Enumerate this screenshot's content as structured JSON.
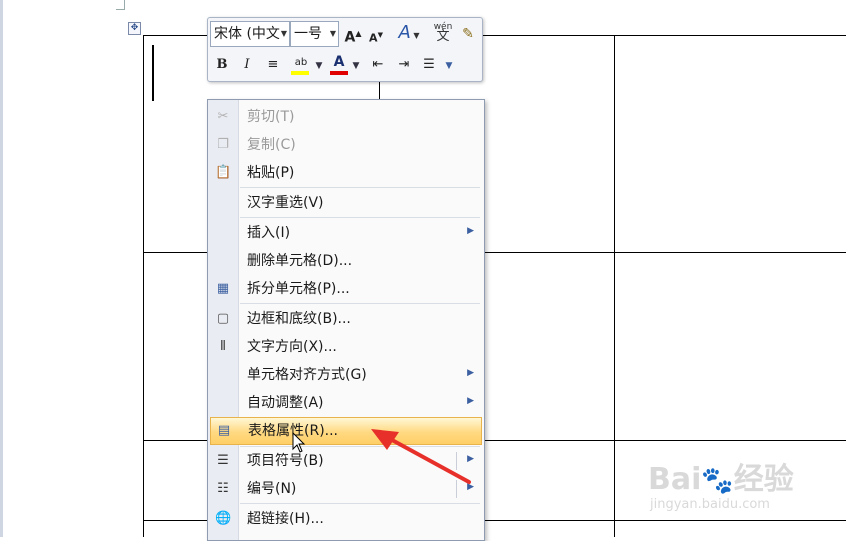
{
  "mini_toolbar": {
    "font_name": "宋体 (中文",
    "font_size": "一号",
    "grow_font": "A",
    "shrink_font": "A",
    "styles": "A",
    "phonetic": "wén",
    "bold": "B",
    "italic": "I",
    "highlight": "ab",
    "font_color": "A",
    "highlight_color": "#ffff00",
    "font_color_value": "#e00000"
  },
  "context_menu": {
    "items": [
      {
        "label": "剪切(T)",
        "icon": "scissors-icon",
        "disabled": true
      },
      {
        "label": "复制(C)",
        "icon": "copy-icon",
        "disabled": true
      },
      {
        "label": "粘贴(P)",
        "icon": "paste-icon",
        "disabled": false
      },
      {
        "label": "汉字重选(V)",
        "icon": "",
        "disabled": false
      },
      {
        "label": "插入(I)",
        "icon": "",
        "disabled": false,
        "submenu": true
      },
      {
        "label": "删除单元格(D)...",
        "icon": "",
        "disabled": false
      },
      {
        "label": "拆分单元格(P)...",
        "icon": "split-cells-icon",
        "disabled": false
      },
      {
        "label": "边框和底纹(B)...",
        "icon": "borders-icon",
        "disabled": false
      },
      {
        "label": "文字方向(X)...",
        "icon": "text-direction-icon",
        "disabled": false
      },
      {
        "label": "单元格对齐方式(G)",
        "icon": "",
        "disabled": false,
        "submenu": true
      },
      {
        "label": "自动调整(A)",
        "icon": "",
        "disabled": false,
        "submenu": true
      },
      {
        "label": "表格属性(R)...",
        "icon": "table-properties-icon",
        "disabled": false,
        "highlighted": true
      },
      {
        "label": "项目符号(B)",
        "icon": "bullets-icon",
        "disabled": false,
        "submenu": true
      },
      {
        "label": "编号(N)",
        "icon": "numbering-icon",
        "disabled": false,
        "submenu": true
      },
      {
        "label": "超链接(H)...",
        "icon": "hyperlink-icon",
        "disabled": false
      }
    ]
  },
  "annotation": {
    "arrow_color": "#e8302a"
  },
  "watermark": {
    "brand": "Bai 经验",
    "url": "jingyan.baidu.com"
  }
}
